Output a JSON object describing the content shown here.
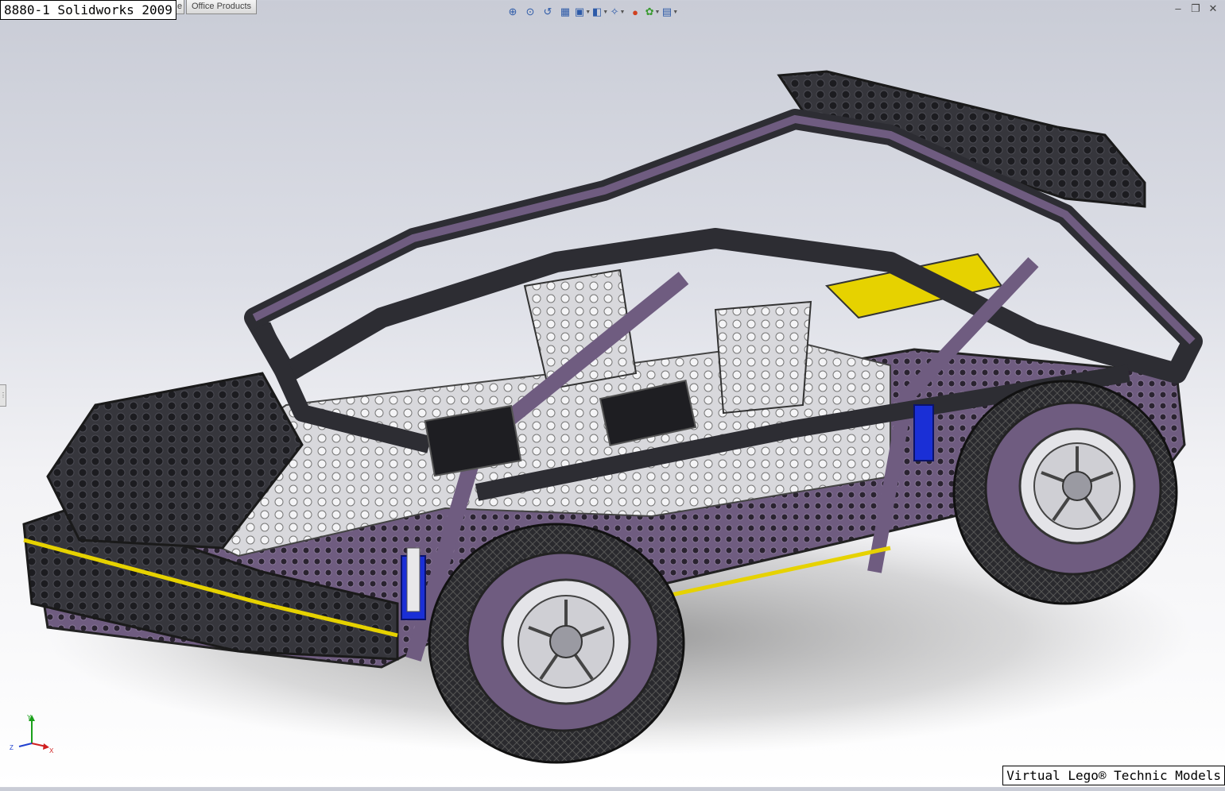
{
  "overlay": {
    "model_title": "8880-1 Solidworks 2009",
    "credit": "Virtual Lego® Technic Models"
  },
  "tabs": [
    {
      "label": "e"
    },
    {
      "label": "Office Products"
    }
  ],
  "heads_up_toolbar": [
    {
      "icon": "zoom-to-fit-icon",
      "glyph": "⊕"
    },
    {
      "icon": "zoom-area-icon",
      "glyph": "⊙"
    },
    {
      "icon": "previous-view-icon",
      "glyph": "↺"
    },
    {
      "icon": "section-view-icon",
      "glyph": "▦"
    },
    {
      "icon": "view-orientation-icon",
      "glyph": "▣"
    },
    {
      "icon": "display-style-icon",
      "glyph": "◧"
    },
    {
      "icon": "hide-show-items-icon",
      "glyph": "✧"
    },
    {
      "icon": "edit-appearance-icon",
      "glyph": "●"
    },
    {
      "icon": "apply-scene-icon",
      "glyph": "✿"
    },
    {
      "icon": "view-settings-icon",
      "glyph": "▤"
    }
  ],
  "window_controls": [
    {
      "icon": "minimize-icon",
      "glyph": "–"
    },
    {
      "icon": "restore-icon",
      "glyph": "❐"
    },
    {
      "icon": "close-icon",
      "glyph": "✕"
    }
  ],
  "colors": {
    "frame_purple": "#6f5c80",
    "beam_dark": "#2d2d33",
    "stud_black": "#1e1e22",
    "accent_yellow": "#e6d200",
    "shock_blue": "#1a2fd6",
    "light_gray": "#d8d8dc"
  },
  "triad": {
    "x_label": "X",
    "y_label": "Y",
    "z_label": "Z"
  }
}
